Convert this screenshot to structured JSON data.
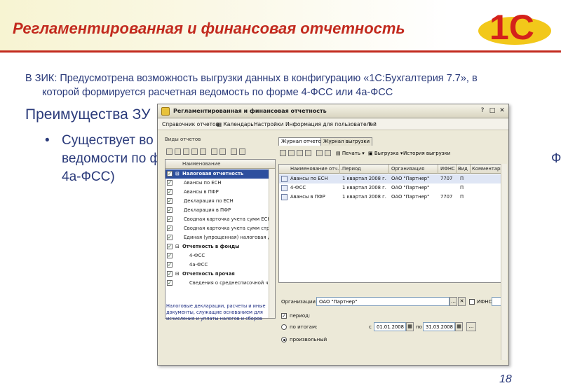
{
  "slide": {
    "title": "Регламентированная и финансовая отчетность",
    "intro_line1": "В ЗИК: Предусмотрена возможность выгрузки данных в конфигурацию «1С:Бухгалтерия 7.7», в",
    "intro_line2": "которой формируется расчетная ведомость по форме 4-ФСС или 4а-ФСС",
    "advantages_heading": "Преимущества ЗУ",
    "bullet_line1": "Существует во",
    "bullet_line2": "ведомости по ф",
    "bullet_line2_right": "ФСС,",
    "bullet_line3": "4а-ФСС)",
    "slide_number": "18",
    "logo_text": "1С",
    "colors": {
      "title": "#c22a1e",
      "text": "#2a3a7a",
      "logo_red": "#d4211b",
      "logo_yellow": "#f2c81a"
    }
  },
  "window": {
    "title": "Регламентированная и финансовая отчетность",
    "controls": {
      "close": "✕",
      "maximize": "□",
      "help": "?"
    },
    "menu": [
      "Справочник отчетов",
      "Календарь",
      "Настройки",
      "Информация для пользователей",
      "?"
    ]
  },
  "left_panel": {
    "caption": "Виды отчетов",
    "column_header": "Наименование",
    "tree": [
      {
        "label": "Налоговая отчетность",
        "expander": "⊟",
        "checked": true,
        "group": true,
        "level": 0,
        "selected": true
      },
      {
        "label": "Авансы по ЕСН",
        "checked": true,
        "level": 1
      },
      {
        "label": "Авансы в ПФР",
        "checked": true,
        "level": 1
      },
      {
        "label": "Декларация по ЕСН",
        "checked": true,
        "level": 1
      },
      {
        "label": "Декларация в ПФР",
        "checked": true,
        "level": 1
      },
      {
        "label": "Сводная карточка учета сумм ЕСН",
        "checked": true,
        "level": 1
      },
      {
        "label": "Сводная карточка учета сумм стр...",
        "checked": true,
        "level": 1
      },
      {
        "label": "Единая (упрощенная) налоговая д...",
        "checked": true,
        "level": 1
      },
      {
        "label": "Отчетность в фонды",
        "expander": "⊟",
        "checked": true,
        "group": true,
        "level": 0
      },
      {
        "label": "4-ФСС",
        "checked": true,
        "level": 1
      },
      {
        "label": "4а-ФСС",
        "checked": true,
        "level": 1
      },
      {
        "label": "Отчетность прочая",
        "expander": "⊟",
        "checked": true,
        "group": true,
        "level": 0
      },
      {
        "label": "Сведения о среднесписочной чис...",
        "checked": true,
        "level": 1
      }
    ],
    "description": "Налоговые декларации, расчеты и иные документы, служащие основанием для исчисления и уплаты налогов и сборов"
  },
  "right_panel": {
    "tabs": [
      "Журнал отчетов",
      "Журнал выгрузки"
    ],
    "toolbar": {
      "print": "Печать",
      "upload": "Выгрузка",
      "history": "История выгрузки"
    },
    "columns": [
      "Наименование отч...",
      "Период",
      "Организация",
      "ИФНС",
      "Вид",
      "Комментарий"
    ],
    "rows": [
      [
        "Авансы по ЕСН",
        "1 квартал 2008 г.",
        "ОАО \"Партнер\"",
        "7707",
        "П",
        ""
      ],
      [
        "4-ФСС",
        "1 квартал 2008 г.",
        "ОАО \"Партнер\"",
        "",
        "П",
        ""
      ],
      [
        "Авансы в ПФР",
        "1 квартал 2008 г.",
        "ОАО \"Партнер\"",
        "7707",
        "П",
        ""
      ]
    ],
    "filter": {
      "organization_label": "Организации:",
      "organization_value": "ОАО \"Партнер\"",
      "ifns_label": "ИФНС:",
      "period_label": "период:",
      "by_totals_label": "по итогам:",
      "from_label": "с",
      "from_date": "01.01.2008",
      "to_label": "по",
      "to_date": "31.03.2008",
      "arbitrary_label": "произвольный",
      "ellipsis": "..."
    }
  }
}
